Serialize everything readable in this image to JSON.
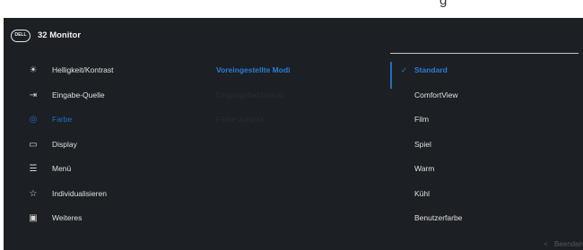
{
  "top_fragment": "g",
  "header": {
    "logo_text": "DELL",
    "title": "32 Monitor"
  },
  "menu": [
    {
      "icon": "brightness-icon",
      "glyph": "☀",
      "label": "Helligkeit/Kontrast"
    },
    {
      "icon": "input-source-icon",
      "glyph": "⇥",
      "label": "Eingabe-Quelle"
    },
    {
      "icon": "color-palette-icon",
      "glyph": "◎",
      "label": "Farbe"
    },
    {
      "icon": "display-icon",
      "glyph": "▭",
      "label": "Display"
    },
    {
      "icon": "menu-icon",
      "glyph": "☰",
      "label": "Menü"
    },
    {
      "icon": "star-icon",
      "glyph": "☆",
      "label": "Individualisieren"
    },
    {
      "icon": "others-icon",
      "glyph": "▣",
      "label": "Weiteres"
    }
  ],
  "submenu": [
    "Voreingestellte Modi",
    "Eingangsfarbformat",
    "Farbe zurücks."
  ],
  "options": {
    "check_glyph": "✓",
    "items": [
      "Standard",
      "ComfortView",
      "Film",
      "Spiel",
      "Warm",
      "Kühl",
      "Benutzerfarbe"
    ]
  },
  "footer": {
    "chevron": "<",
    "label": "Beenden"
  },
  "colors": {
    "accent": "#1e6fc2",
    "background": "#1c1f23"
  }
}
